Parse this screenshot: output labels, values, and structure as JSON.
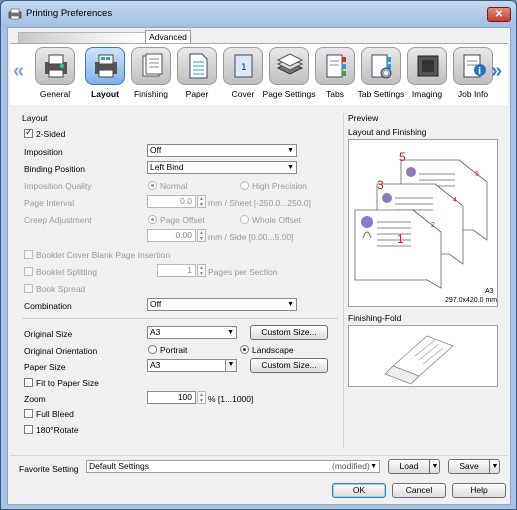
{
  "window": {
    "title": "Printing Preferences",
    "close_label": "✕"
  },
  "top_tab": {
    "label": "Advanced"
  },
  "tabs": [
    {
      "label": "General",
      "icon": "general-printer-icon"
    },
    {
      "label": "Layout",
      "icon": "layout-icon",
      "active": true
    },
    {
      "label": "Finishing",
      "icon": "finishing-icon"
    },
    {
      "label": "Paper",
      "icon": "paper-icon"
    },
    {
      "label": "Cover",
      "icon": "cover-icon"
    },
    {
      "label": "Page Settings",
      "icon": "page-settings-icon"
    },
    {
      "label": "Tabs",
      "icon": "tabs-icon"
    },
    {
      "label": "Tab Settings",
      "icon": "tab-settings-icon"
    },
    {
      "label": "Imaging",
      "icon": "imaging-icon"
    },
    {
      "label": "Job Info",
      "icon": "job-info-icon"
    }
  ],
  "layout": {
    "section": "Layout",
    "two_sided": "2-Sided",
    "imposition_label": "Imposition",
    "imposition_value": "Off",
    "binding_label": "Binding Position",
    "binding_value": "Left Bind",
    "imposition_quality_label": "Imposition Quality",
    "quality_normal": "Normal",
    "quality_high": "High Precision",
    "page_interval_label": "Page Interval",
    "page_interval_value": "0.0",
    "page_interval_unit": "mm / Sheet [-250.0...250.0]",
    "creep_label": "Creep Adjustment",
    "creep_page_offset": "Page Offset",
    "creep_whole_offset": "Whole Offset",
    "creep_value": "0.00",
    "creep_unit": "mm / Side [0.00...5.00]",
    "booklet_blank": "Booklet Cover Blank Page Insertion",
    "booklet_splitting": "Booklet Splitting",
    "booklet_value": "1",
    "booklet_unit": "Pages per Section",
    "book_spread": "Book Spread",
    "combination_label": "Combination",
    "combination_value": "Off",
    "original_size_label": "Original Size",
    "original_size_value": "A3",
    "custom_size_btn": "Custom Size...",
    "orientation_label": "Original Orientation",
    "portrait": "Portrait",
    "landscape": "Landscape",
    "paper_size_label": "Paper Size",
    "paper_size_value": "A3",
    "custom_size_btn2": "Custom Size...",
    "fit_to_paper": "Fit to Paper Size",
    "zoom_label": "Zoom",
    "zoom_value": "100",
    "zoom_unit": "% [1...1000]",
    "full_bleed": "Full Bleed",
    "rotate": "180°Rotate"
  },
  "preview": {
    "section": "Preview",
    "layout_finishing": "Layout and Finishing",
    "paper_name": "A3",
    "paper_dims": "297.0x420.0 mm",
    "page_numbers": [
      "5",
      "6",
      "3",
      "4",
      "1",
      "2"
    ],
    "finishing_fold": "Finishing-Fold"
  },
  "favorite": {
    "label": "Favorite Setting",
    "value": "Default Settings",
    "modified": "(modified)",
    "load": "Load",
    "save": "Save"
  },
  "buttons": {
    "ok": "OK",
    "cancel": "Cancel",
    "help": "Help"
  },
  "colors": {
    "accent": "#3d7cc9",
    "page_number": "#cc2222"
  }
}
